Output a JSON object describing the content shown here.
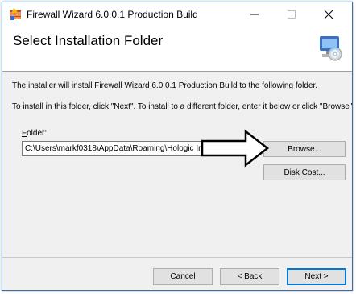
{
  "window": {
    "title": "Firewall Wizard 6.0.0.1 Production Build",
    "controls": {
      "minimize": "–",
      "maximize": "☐",
      "close": "✕"
    }
  },
  "header": {
    "title": "Select Installation Folder",
    "icon": "installer-computer-disc-icon"
  },
  "body": {
    "line1": "The installer will install Firewall Wizard 6.0.0.1 Production Build to the following folder.",
    "line2": "To install in this folder, click \"Next\". To install to a different folder, enter it below or click \"Browse\".",
    "folder_label_mnemonic": "F",
    "folder_label_rest": "older:",
    "folder_value": "C:\\Users\\markf0318\\AppData\\Roaming\\Hologic Inc\\",
    "browse_label": "Browse...",
    "disk_cost_label": "Disk Cost..."
  },
  "footer": {
    "cancel_label": "Cancel",
    "back_label": "< Back",
    "next_label": "Next >"
  },
  "colors": {
    "window_bg": "#f0f0f0",
    "header_bg": "#ffffff",
    "button_bg": "#e1e1e1",
    "default_button_border": "#0078d7"
  }
}
